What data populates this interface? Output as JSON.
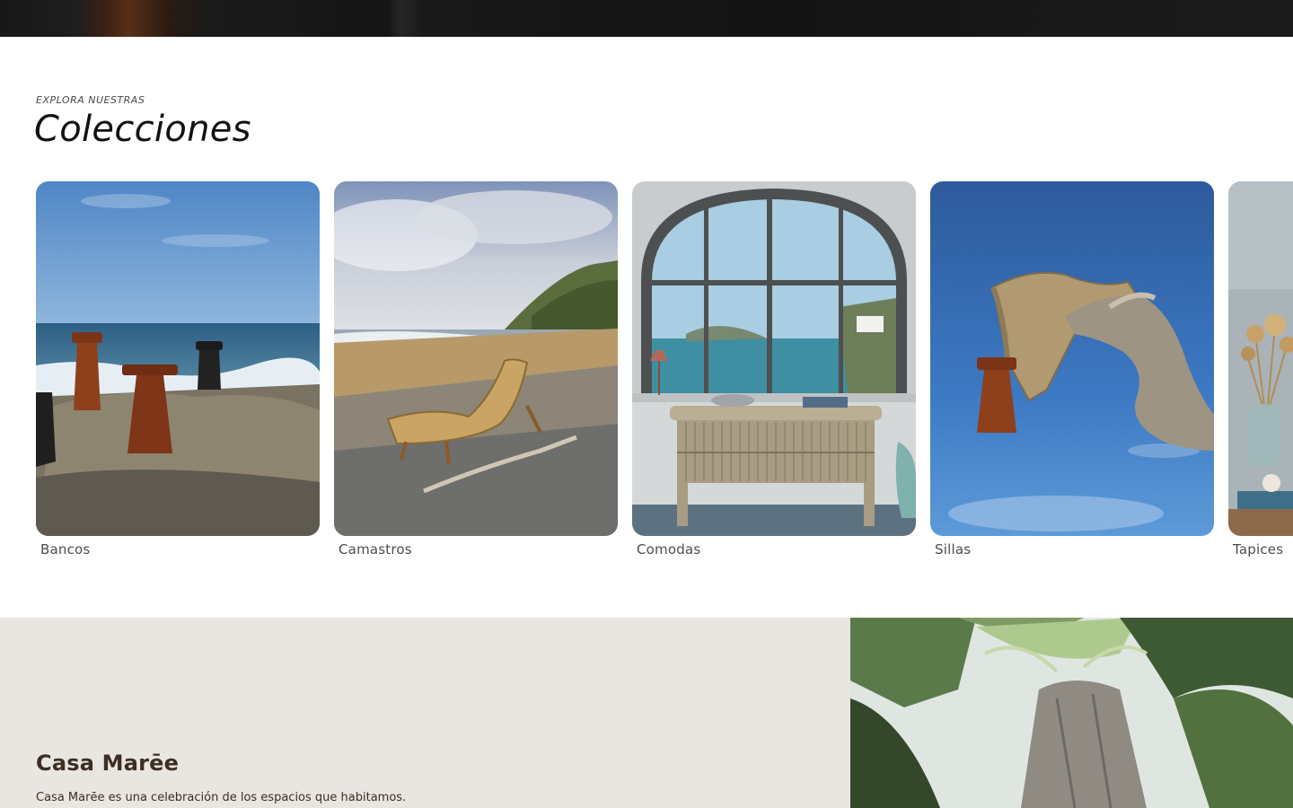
{
  "collections": {
    "eyebrow": "EXPLORA NUESTRAS",
    "title": "Colecciones",
    "items": [
      {
        "label": "Bancos"
      },
      {
        "label": "Camastros"
      },
      {
        "label": "Comodas"
      },
      {
        "label": "Sillas"
      },
      {
        "label": "Tapices"
      }
    ]
  },
  "about": {
    "title": "Casa Marēe",
    "text": "Casa Marēe es una celebración de los espacios que habitamos."
  },
  "colors": {
    "accent_text": "#3c2e24",
    "about_bg": "#e9e5e1"
  }
}
